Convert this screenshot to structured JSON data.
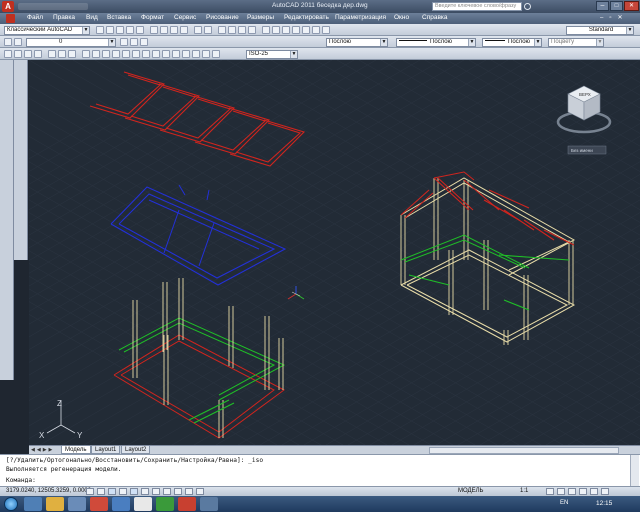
{
  "window": {
    "app_title": "AutoCAD 2011   беседка дер.dwg",
    "search_placeholder": "Введите ключевое слово/фразу"
  },
  "menu": {
    "items": [
      "Файл",
      "Правка",
      "Вид",
      "Вставка",
      "Формат",
      "Сервис",
      "Рисование",
      "Размеры",
      "Редактировать",
      "Параметризация",
      "Окно",
      "Справка"
    ]
  },
  "toolbar1": {
    "workspace": "Классический AutoCAD",
    "standard": "Standard"
  },
  "toolbar2": {
    "layer": "0",
    "color": "Послою",
    "linetype": "Послою",
    "lineweight": "Послою",
    "plotstyle": "Поцвету"
  },
  "toolbar3": {
    "dimstyle": "ISO-25"
  },
  "viewcube": {
    "face_label": "ВЕРХ",
    "wcs_label": "Без имени"
  },
  "tabs": {
    "model": "Модель",
    "layout1": "Layout1",
    "layout2": "Layout2"
  },
  "command": {
    "line1": "[?/Удалить/Ортогонально/Восстановить/Сохранить/Настройка/Равна]: _iso",
    "line2": "Выполняется регенерация модели.",
    "prompt": "Команда:"
  },
  "status": {
    "coords": "3179.0240, 12505.3259, 0.0000",
    "model_label": "МОДЕЛЬ",
    "scale": "1:1",
    "lang": "EN",
    "clock": "12:15"
  },
  "colors": {
    "red": "#d0251e",
    "blue": "#2230d8",
    "green": "#1fbf27",
    "beige": "#e8dca8",
    "viewport_bg": "#222b36"
  },
  "axis": {
    "x": "X",
    "y": "Y",
    "z": "Z"
  }
}
